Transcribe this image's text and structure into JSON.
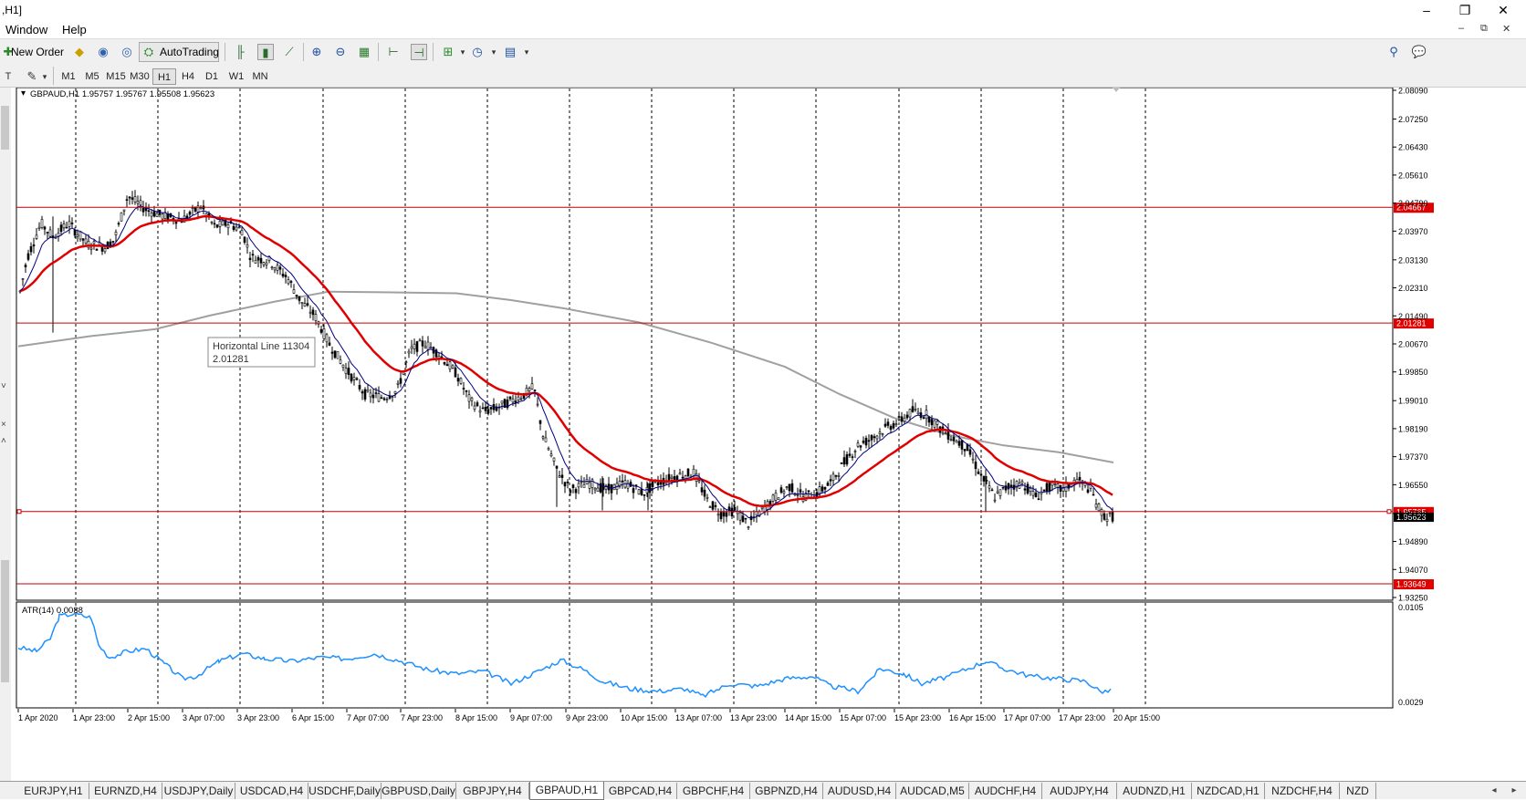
{
  "window": {
    "title": ",H1]",
    "minimize_glyph": "–",
    "restore_glyph": "❐",
    "close_glyph": "✕"
  },
  "menu": {
    "items": [
      "Window",
      "Help"
    ],
    "mdi_minimize": "–",
    "mdi_restore": "⧉",
    "mdi_close": "✕"
  },
  "toolbar": {
    "new_order_label": "New Order",
    "autotrading_label": "AutoTrading"
  },
  "timeframes": [
    "M1",
    "M5",
    "M15",
    "M30",
    "H1",
    "H4",
    "D1",
    "W1",
    "MN"
  ],
  "active_timeframe": "H1",
  "chart": {
    "header": "GBPAUD,H1  1.95757 1.95767 1.95508 1.95623",
    "price_ticks": [
      "2.08090",
      "2.07250",
      "2.06430",
      "2.05610",
      "2.04790",
      "2.03970",
      "2.03130",
      "2.02310",
      "2.01490",
      "2.00670",
      "1.99850",
      "1.99010",
      "1.98190",
      "1.97370",
      "1.96550",
      "1.95710",
      "1.94890",
      "1.94070",
      "1.93250"
    ],
    "horizontal_lines": [
      {
        "value": "2.04667",
        "color": "#c00000"
      },
      {
        "value": "2.01281",
        "color": "#c00000"
      },
      {
        "value": "1.95765",
        "color": "#c00000"
      },
      {
        "value": "1.93649",
        "color": "#c00000"
      }
    ],
    "current_price_label": "1.95623",
    "tooltip": {
      "name": "Horizontal Line 11304",
      "value": "2.01281"
    },
    "time_labels": [
      "1 Apr 2020",
      "1 Apr 23:00",
      "2 Apr 15:00",
      "3 Apr 07:00",
      "3 Apr 23:00",
      "6 Apr 15:00",
      "7 Apr 07:00",
      "7 Apr 23:00",
      "8 Apr 15:00",
      "9 Apr 07:00",
      "9 Apr 23:00",
      "10 Apr 15:00",
      "13 Apr 07:00",
      "13 Apr 23:00",
      "14 Apr 15:00",
      "15 Apr 07:00",
      "15 Apr 23:00",
      "16 Apr 15:00",
      "17 Apr 07:00",
      "17 Apr 23:00",
      "20 Apr 15:00"
    ],
    "atr_label": "ATR(14) 0.0088",
    "atr_ticks": [
      "0.0105",
      "0.0029"
    ],
    "colors": {
      "candle": "#000000",
      "ma_fast": "#000080",
      "ma_mid": "#e00000",
      "ma_slow": "#a0a0a0",
      "atr": "#1e90ff",
      "hline": "#c00000"
    }
  },
  "tabs": [
    "EURJPY,H1",
    "EURNZD,H4",
    "USDJPY,Daily",
    "USDCAD,H4",
    "USDCHF,Daily",
    "GBPUSD,Daily",
    "GBPJPY,H4",
    "GBPAUD,H1",
    "GBPCAD,H4",
    "GBPCHF,H4",
    "GBPNZD,H4",
    "AUDUSD,H4",
    "AUDCAD,M5",
    "AUDCHF,H4",
    "AUDJPY,H4",
    "AUDNZD,H1",
    "NZDCAD,H1",
    "NZDCHF,H4",
    "NZD"
  ],
  "active_tab": "GBPAUD,H1"
}
